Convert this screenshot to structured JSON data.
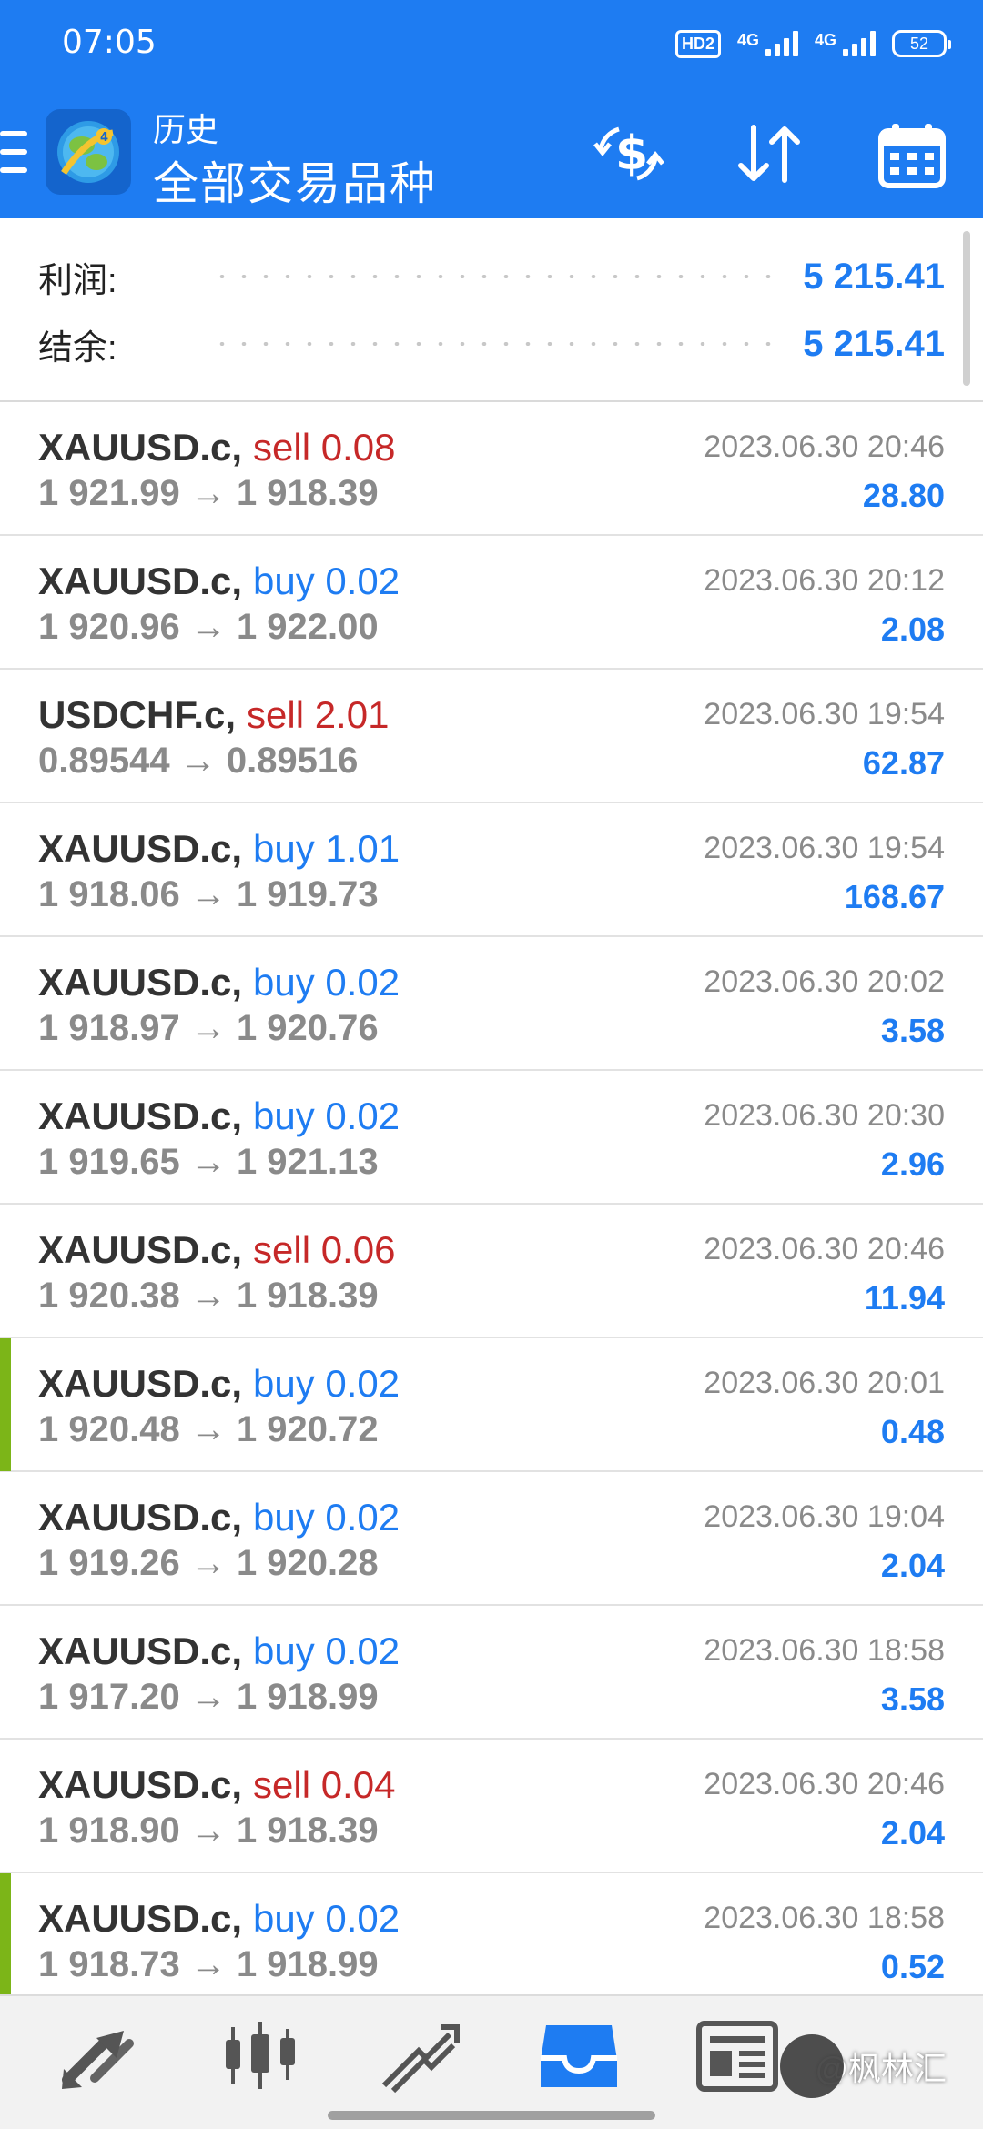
{
  "status_bar": {
    "time": "07:05",
    "hd_label": "HD2",
    "network_1": "4G",
    "network_2": "4G",
    "battery": "52"
  },
  "header": {
    "subtitle": "历史",
    "title": "全部交易品种",
    "icons": [
      "menu-icon",
      "metatrader-logo",
      "currency-exchange-icon",
      "sort-icon",
      "calendar-icon"
    ],
    "accent_color": "#1E7CF2"
  },
  "summary": {
    "profit_label": "利润:",
    "profit_value": "5 215.41",
    "balance_label": "结余:",
    "balance_value": "5 215.41"
  },
  "colors": {
    "sell": "#C62828",
    "buy": "#1E7CF2",
    "profit": "#1E7CF2",
    "marker": "#7CB518"
  },
  "trades": [
    {
      "symbol": "XAUUSD.c,",
      "side": "sell",
      "volume": "0.08",
      "open": "1 921.99",
      "close": "1 918.39",
      "time": "2023.06.30 20:46",
      "profit": "28.80",
      "marked": false
    },
    {
      "symbol": "XAUUSD.c,",
      "side": "buy",
      "volume": "0.02",
      "open": "1 920.96",
      "close": "1 922.00",
      "time": "2023.06.30 20:12",
      "profit": "2.08",
      "marked": false
    },
    {
      "symbol": "USDCHF.c,",
      "side": "sell",
      "volume": "2.01",
      "open": "0.89544",
      "close": "0.89516",
      "time": "2023.06.30 19:54",
      "profit": "62.87",
      "marked": false
    },
    {
      "symbol": "XAUUSD.c,",
      "side": "buy",
      "volume": "1.01",
      "open": "1 918.06",
      "close": "1 919.73",
      "time": "2023.06.30 19:54",
      "profit": "168.67",
      "marked": false
    },
    {
      "symbol": "XAUUSD.c,",
      "side": "buy",
      "volume": "0.02",
      "open": "1 918.97",
      "close": "1 920.76",
      "time": "2023.06.30 20:02",
      "profit": "3.58",
      "marked": false
    },
    {
      "symbol": "XAUUSD.c,",
      "side": "buy",
      "volume": "0.02",
      "open": "1 919.65",
      "close": "1 921.13",
      "time": "2023.06.30 20:30",
      "profit": "2.96",
      "marked": false
    },
    {
      "symbol": "XAUUSD.c,",
      "side": "sell",
      "volume": "0.06",
      "open": "1 920.38",
      "close": "1 918.39",
      "time": "2023.06.30 20:46",
      "profit": "11.94",
      "marked": false
    },
    {
      "symbol": "XAUUSD.c,",
      "side": "buy",
      "volume": "0.02",
      "open": "1 920.48",
      "close": "1 920.72",
      "time": "2023.06.30 20:01",
      "profit": "0.48",
      "marked": true
    },
    {
      "symbol": "XAUUSD.c,",
      "side": "buy",
      "volume": "0.02",
      "open": "1 919.26",
      "close": "1 920.28",
      "time": "2023.06.30 19:04",
      "profit": "2.04",
      "marked": false
    },
    {
      "symbol": "XAUUSD.c,",
      "side": "buy",
      "volume": "0.02",
      "open": "1 917.20",
      "close": "1 918.99",
      "time": "2023.06.30 18:58",
      "profit": "3.58",
      "marked": false
    },
    {
      "symbol": "XAUUSD.c,",
      "side": "sell",
      "volume": "0.04",
      "open": "1 918.90",
      "close": "1 918.39",
      "time": "2023.06.30 20:46",
      "profit": "2.04",
      "marked": false
    },
    {
      "symbol": "XAUUSD.c,",
      "side": "buy",
      "volume": "0.02",
      "open": "1 918.73",
      "close": "1 918.99",
      "time": "2023.06.30 18:58",
      "profit": "0.52",
      "marked": true
    }
  ],
  "bottom_nav": {
    "items": [
      "quotes-icon",
      "chart-icon",
      "trade-icon",
      "history-icon",
      "news-icon"
    ],
    "active": "history-icon"
  },
  "watermark": {
    "text": "@枫林汇"
  }
}
